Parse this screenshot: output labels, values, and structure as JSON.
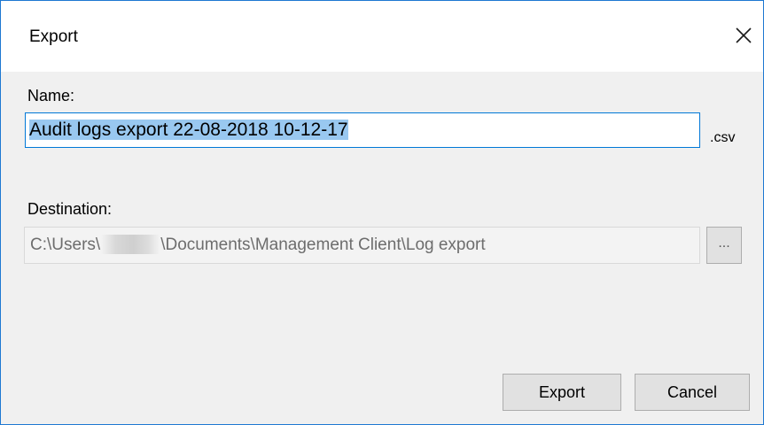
{
  "window": {
    "title": "Export",
    "close_icon": "close-icon"
  },
  "form": {
    "name_label": "Name:",
    "name_value": "Audit logs export 22-08-2018 10-12-17",
    "extension": ".csv",
    "destination_label": "Destination:",
    "destination_prefix": "C:\\Users\\",
    "destination_suffix": "\\Documents\\Management Client\\Log export",
    "browse_label": "..."
  },
  "buttons": {
    "export_label": "Export",
    "cancel_label": "Cancel"
  },
  "colors": {
    "accent": "#0078d7",
    "window_border": "#1e78d2",
    "selection": "#99c8f0",
    "dialog_body": "#f0f0f0"
  }
}
